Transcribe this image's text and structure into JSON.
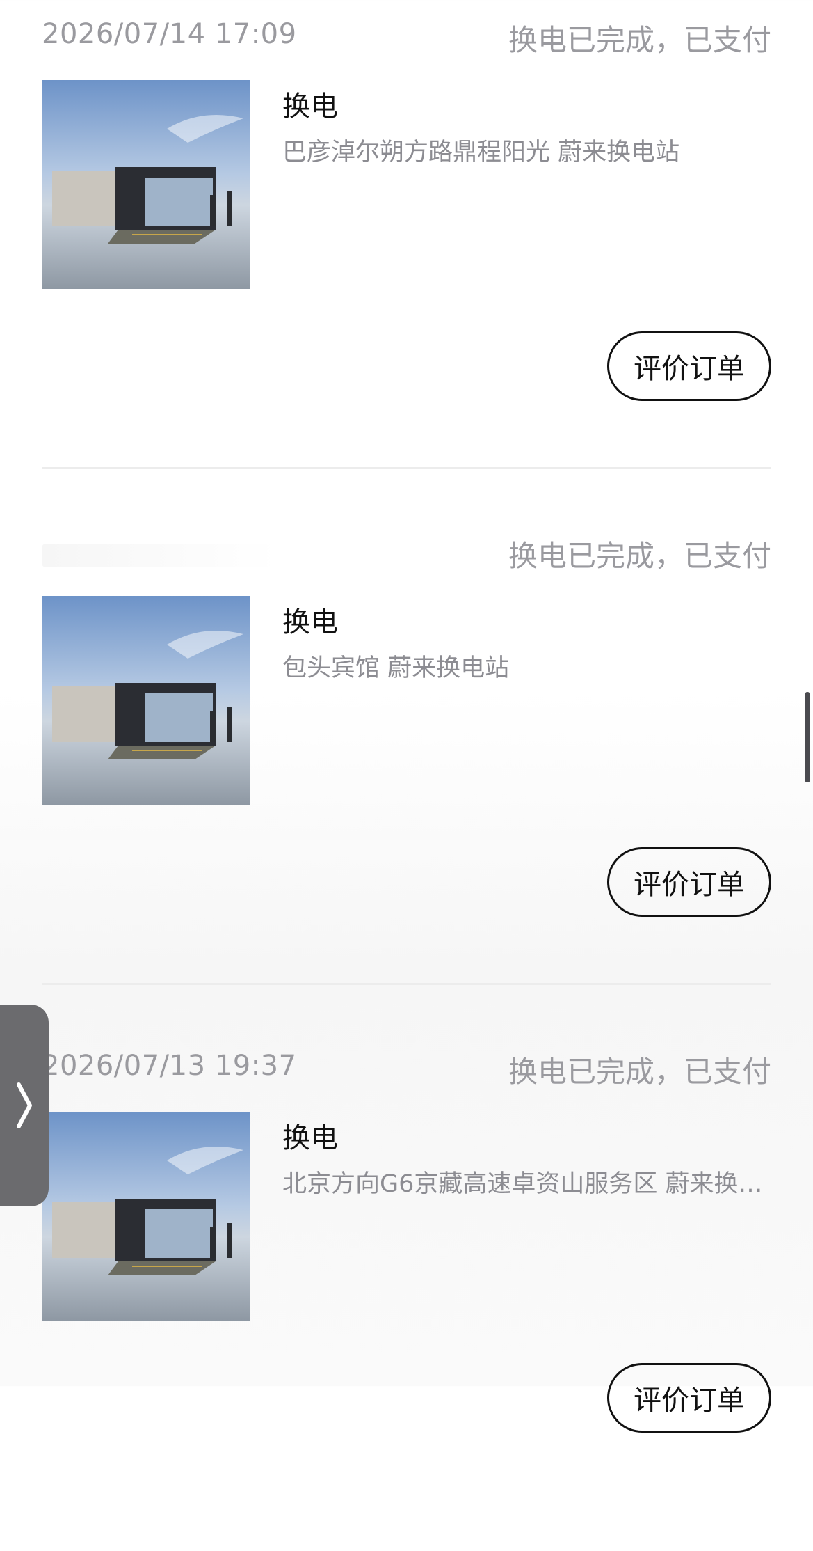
{
  "orders": [
    {
      "time": "2026/07/14 17:09",
      "status": "换电已完成，已支付",
      "type": "换电",
      "station": "巴彦淖尔朔方路鼎程阳光 蔚来换电站",
      "action": "评价订单"
    },
    {
      "time": "",
      "status": "换电已完成，已支付",
      "type": "换电",
      "station": "包头宾馆 蔚来换电站",
      "action": "评价订单"
    },
    {
      "time": "2026/07/13 19:37",
      "status": "换电已完成，已支付",
      "type": "换电",
      "station": "北京方向G6京藏高速卓资山服务区 蔚来换…",
      "action": "评价订单"
    }
  ],
  "icons": {
    "side_handle": "chevron-right-icon",
    "thumbnail": "swap-station-image"
  },
  "colors": {
    "muted_text": "#9a9a9f",
    "primary_text": "#111111",
    "divider": "#ececec",
    "handle": "#6b6b6e"
  }
}
